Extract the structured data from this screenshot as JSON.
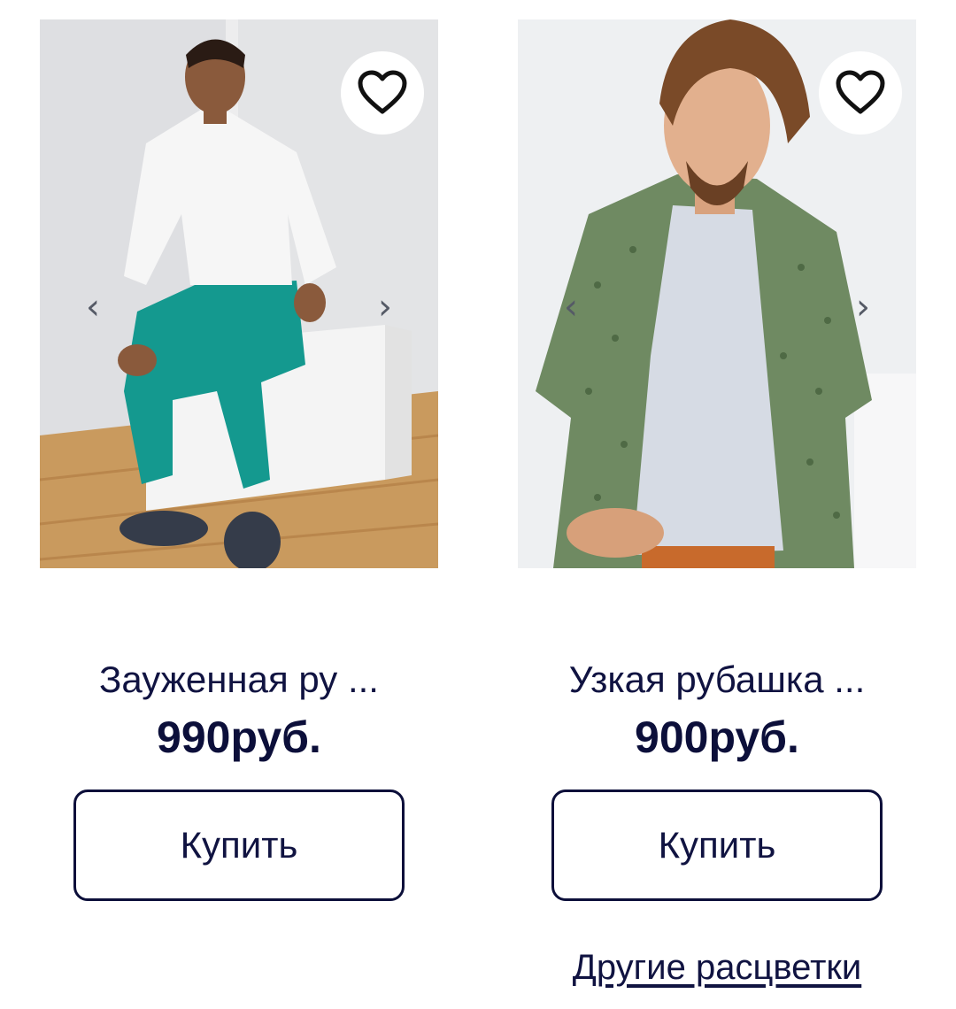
{
  "products": [
    {
      "title": "Зауженная ру ...",
      "price": "990руб.",
      "buy_label": "Купить",
      "favorite_icon": "heart-outline-icon",
      "prev_arrow": "‹",
      "next_arrow": "›"
    },
    {
      "title": "Узкая рубашка ...",
      "price": "900руб.",
      "buy_label": "Купить",
      "favorite_icon": "heart-outline-icon",
      "prev_arrow": "‹",
      "next_arrow": "›",
      "other_colors_label": "Другие расцветки"
    }
  ],
  "colors": {
    "text": "#101341",
    "button_border": "#0c0f3a",
    "background": "#ffffff"
  }
}
